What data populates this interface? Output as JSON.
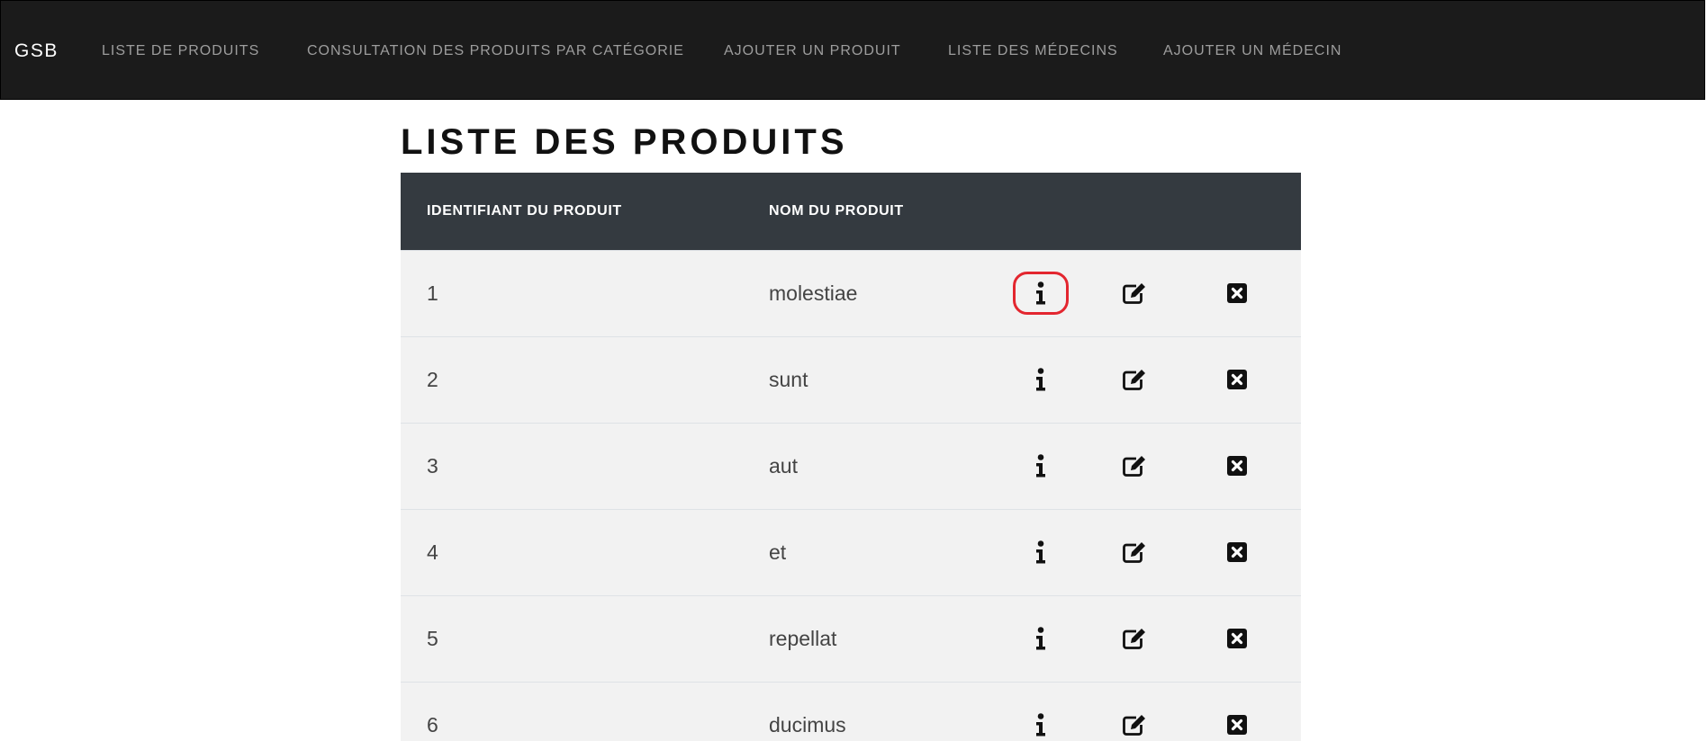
{
  "navbar": {
    "brand": "GSB",
    "links": [
      "LISTE DE PRODUITS",
      "CONSULTATION DES PRODUITS PAR CATÉGORIE",
      "AJOUTER UN PRODUIT",
      "LISTE DES MÉDECINS",
      "AJOUTER UN MÉDECIN"
    ]
  },
  "page": {
    "title": "LISTE DES PRODUITS"
  },
  "table": {
    "headers": [
      "IDENTIFIANT DU PRODUIT",
      "NOM DU PRODUIT",
      "",
      "",
      ""
    ],
    "rows": [
      {
        "id": "1",
        "name": "molestiae"
      },
      {
        "id": "2",
        "name": "sunt"
      },
      {
        "id": "3",
        "name": "aut"
      },
      {
        "id": "4",
        "name": "et"
      },
      {
        "id": "5",
        "name": "repellat"
      },
      {
        "id": "6",
        "name": "ducimus"
      }
    ],
    "actions": [
      "info-icon",
      "edit-icon",
      "delete-icon"
    ]
  },
  "colors": {
    "navbar_bg": "#1b1b1b",
    "table_header_bg": "#343a40",
    "row_bg": "#f2f2f2",
    "highlight": "#e3262f"
  }
}
